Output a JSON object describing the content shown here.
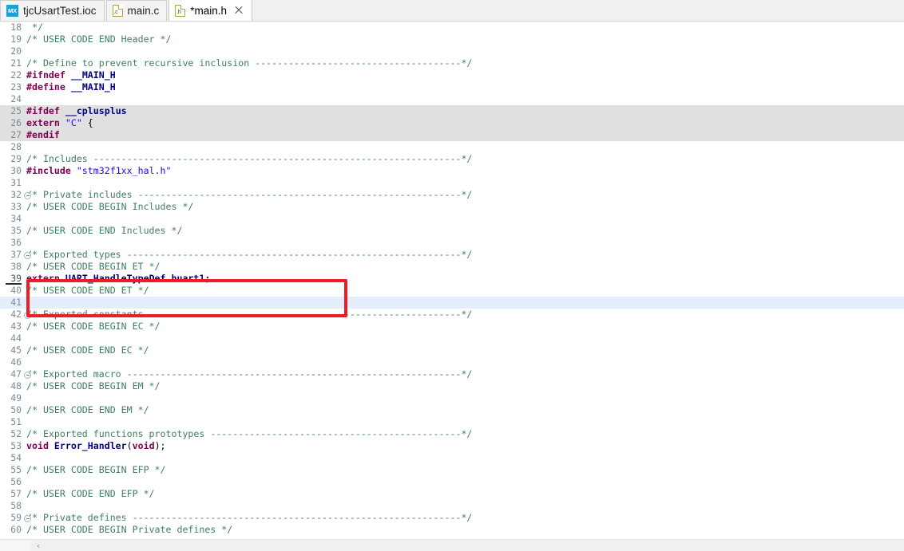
{
  "window": {
    "title": "*main.h",
    "colors": {
      "comment": "#3f7f5f",
      "preprocessor": "#7f0055",
      "keyword": "#7f0055",
      "string": "#2a00ff",
      "identifier": "#000080",
      "annotation_box": "#ee1c24",
      "inactive_block_bg": "#e0e0e0",
      "current_line_bg": "#e4effb",
      "tab_active_bg": "#ffffff",
      "tabbar_bg": "#f0f0f0",
      "mx_icon_bg": "#1ba0d7"
    }
  },
  "tabbar": {
    "tabs": [
      {
        "label": "tjcUsartTest.ioc",
        "icon": "mx-icon",
        "icon_text": "MX",
        "active": false,
        "closable": false,
        "modified": false
      },
      {
        "label": "main.c",
        "icon": "c-file-icon",
        "icon_text": ".c",
        "active": false,
        "closable": false,
        "modified": false
      },
      {
        "label": "*main.h",
        "icon": "h-file-icon",
        "icon_text": ".h",
        "active": true,
        "closable": true,
        "modified": true
      }
    ],
    "close_icon": "close-icon"
  },
  "editor": {
    "first_line": 18,
    "cursor_line": 39,
    "current_line_highlight": 41,
    "inactive_block_lines": [
      25,
      26,
      27
    ],
    "fold_lines": [
      32,
      37,
      42,
      47,
      59
    ],
    "lines": [
      {
        "n": 18,
        "tokens": [
          {
            "t": " */",
            "c": "cmt"
          }
        ]
      },
      {
        "n": 19,
        "tokens": [
          {
            "t": "/* USER CODE END Header */",
            "c": "cmt"
          }
        ]
      },
      {
        "n": 20,
        "tokens": []
      },
      {
        "n": 21,
        "tokens": [
          {
            "t": "/* Define to prevent recursive inclusion -------------------------------------*/",
            "c": "cmt"
          }
        ]
      },
      {
        "n": 22,
        "tokens": [
          {
            "t": "#ifndef",
            "c": "pp"
          },
          {
            "t": " __MAIN_H",
            "c": "id"
          }
        ]
      },
      {
        "n": 23,
        "tokens": [
          {
            "t": "#define",
            "c": "pp"
          },
          {
            "t": " __MAIN_H",
            "c": "id"
          }
        ]
      },
      {
        "n": 24,
        "tokens": []
      },
      {
        "n": 25,
        "tokens": [
          {
            "t": "#ifdef",
            "c": "pp"
          },
          {
            "t": " __cplusplus",
            "c": "id"
          }
        ]
      },
      {
        "n": 26,
        "tokens": [
          {
            "t": "extern",
            "c": "kw"
          },
          {
            "t": " ",
            "c": "plain"
          },
          {
            "t": "\"C\"",
            "c": "str"
          },
          {
            "t": " {",
            "c": "plain"
          }
        ]
      },
      {
        "n": 27,
        "tokens": [
          {
            "t": "#endif",
            "c": "pp"
          }
        ]
      },
      {
        "n": 28,
        "tokens": []
      },
      {
        "n": 29,
        "tokens": [
          {
            "t": "/* Includes ------------------------------------------------------------------*/",
            "c": "cmt"
          }
        ]
      },
      {
        "n": 30,
        "tokens": [
          {
            "t": "#include",
            "c": "pp"
          },
          {
            "t": " ",
            "c": "plain"
          },
          {
            "t": "\"stm32f1xx_hal.h\"",
            "c": "str"
          }
        ]
      },
      {
        "n": 31,
        "tokens": []
      },
      {
        "n": 32,
        "tokens": [
          {
            "t": "/* Private includes ----------------------------------------------------------*/",
            "c": "cmt"
          }
        ]
      },
      {
        "n": 33,
        "tokens": [
          {
            "t": "/* USER CODE BEGIN Includes */",
            "c": "cmt"
          }
        ]
      },
      {
        "n": 34,
        "tokens": []
      },
      {
        "n": 35,
        "tokens": [
          {
            "t": "/* USER CODE END Includes */",
            "c": "cmt"
          }
        ]
      },
      {
        "n": 36,
        "tokens": []
      },
      {
        "n": 37,
        "tokens": [
          {
            "t": "/* Exported types ------------------------------------------------------------*/",
            "c": "cmt"
          }
        ]
      },
      {
        "n": 38,
        "tokens": [
          {
            "t": "/* USER CODE BEGIN ET */",
            "c": "cmt"
          }
        ]
      },
      {
        "n": 39,
        "tokens": [
          {
            "t": "extern",
            "c": "kw"
          },
          {
            "t": " ",
            "c": "plain"
          },
          {
            "t": "UART_HandleTypeDef huart1;",
            "c": "id"
          }
        ]
      },
      {
        "n": 40,
        "tokens": [
          {
            "t": "/* USER CODE END ET */",
            "c": "cmt"
          }
        ]
      },
      {
        "n": 41,
        "tokens": []
      },
      {
        "n": 42,
        "tokens": [
          {
            "t": "/* Exported constants --------------------------------------------------------*/",
            "c": "cmt"
          }
        ]
      },
      {
        "n": 43,
        "tokens": [
          {
            "t": "/* USER CODE BEGIN EC */",
            "c": "cmt"
          }
        ]
      },
      {
        "n": 44,
        "tokens": []
      },
      {
        "n": 45,
        "tokens": [
          {
            "t": "/* USER CODE END EC */",
            "c": "cmt"
          }
        ]
      },
      {
        "n": 46,
        "tokens": []
      },
      {
        "n": 47,
        "tokens": [
          {
            "t": "/* Exported macro ------------------------------------------------------------*/",
            "c": "cmt"
          }
        ]
      },
      {
        "n": 48,
        "tokens": [
          {
            "t": "/* USER CODE BEGIN EM */",
            "c": "cmt"
          }
        ]
      },
      {
        "n": 49,
        "tokens": []
      },
      {
        "n": 50,
        "tokens": [
          {
            "t": "/* USER CODE END EM */",
            "c": "cmt"
          }
        ]
      },
      {
        "n": 51,
        "tokens": []
      },
      {
        "n": 52,
        "tokens": [
          {
            "t": "/* Exported functions prototypes ---------------------------------------------*/",
            "c": "cmt"
          }
        ]
      },
      {
        "n": 53,
        "tokens": [
          {
            "t": "void",
            "c": "kw"
          },
          {
            "t": " ",
            "c": "plain"
          },
          {
            "t": "Error_Handler",
            "c": "id"
          },
          {
            "t": "(",
            "c": "plain"
          },
          {
            "t": "void",
            "c": "kw"
          },
          {
            "t": ");",
            "c": "plain"
          }
        ]
      },
      {
        "n": 54,
        "tokens": []
      },
      {
        "n": 55,
        "tokens": [
          {
            "t": "/* USER CODE BEGIN EFP */",
            "c": "cmt"
          }
        ]
      },
      {
        "n": 56,
        "tokens": []
      },
      {
        "n": 57,
        "tokens": [
          {
            "t": "/* USER CODE END EFP */",
            "c": "cmt"
          }
        ]
      },
      {
        "n": 58,
        "tokens": []
      },
      {
        "n": 59,
        "tokens": [
          {
            "t": "/* Private defines -----------------------------------------------------------*/",
            "c": "cmt"
          }
        ]
      },
      {
        "n": 60,
        "tokens": [
          {
            "t": "/* USER CODE BEGIN Private defines */",
            "c": "cmt"
          }
        ]
      }
    ]
  },
  "annotation": {
    "shape": "rectangle",
    "color": "#ee1c24",
    "covers_lines": [
      38,
      39,
      40
    ]
  },
  "scrollbar": {
    "left_arrow_icon": "chevron-left-icon",
    "left_arrow_glyph": "‹"
  }
}
